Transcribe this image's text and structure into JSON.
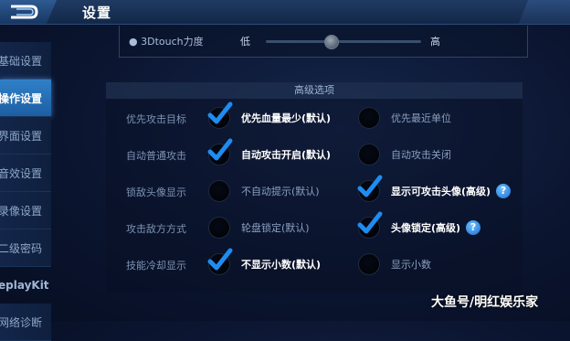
{
  "header": {
    "title": "设置"
  },
  "sidebar": {
    "items": [
      {
        "label": "基础设置",
        "active": false
      },
      {
        "label": "操作设置",
        "active": true
      },
      {
        "label": "界面设置",
        "active": false
      },
      {
        "label": "音效设置",
        "active": false
      },
      {
        "label": "录像设置",
        "active": false
      },
      {
        "label": "二级密码",
        "active": false
      },
      {
        "label": "eplayKit",
        "active": false
      },
      {
        "label": "网络诊断",
        "active": false
      }
    ]
  },
  "touch": {
    "label": "● 3Dtouch力度",
    "low": "低",
    "high": "高",
    "level": 0.42
  },
  "advanced": {
    "title": "高级选项",
    "rows": [
      {
        "label": "优先攻击目标",
        "left": {
          "text": "优先血量最少(默认)",
          "checked": true
        },
        "right": {
          "text": "优先最近单位",
          "checked": false
        }
      },
      {
        "label": "自动普通攻击",
        "left": {
          "text": "自动攻击开启(默认)",
          "checked": true
        },
        "right": {
          "text": "自动攻击关闭",
          "checked": false
        }
      },
      {
        "label": "锁敌头像显示",
        "left": {
          "text": "不自动提示(默认)",
          "checked": false
        },
        "right": {
          "text": "显示可攻击头像(高级)",
          "checked": true,
          "help": "?"
        }
      },
      {
        "label": "攻击敌方方式",
        "left": {
          "text": "轮盘锁定(默认)",
          "checked": false
        },
        "right": {
          "text": "头像锁定(高级)",
          "checked": true,
          "help": "?"
        }
      },
      {
        "label": "技能冷却显示",
        "left": {
          "text": "不显示小数(默认)",
          "checked": true
        },
        "right": {
          "text": "显示小数",
          "checked": false
        }
      }
    ]
  },
  "watermark": "大鱼号/明红娱乐家",
  "colors": {
    "accent": "#2f80c8",
    "check": "#1e8cf0"
  }
}
